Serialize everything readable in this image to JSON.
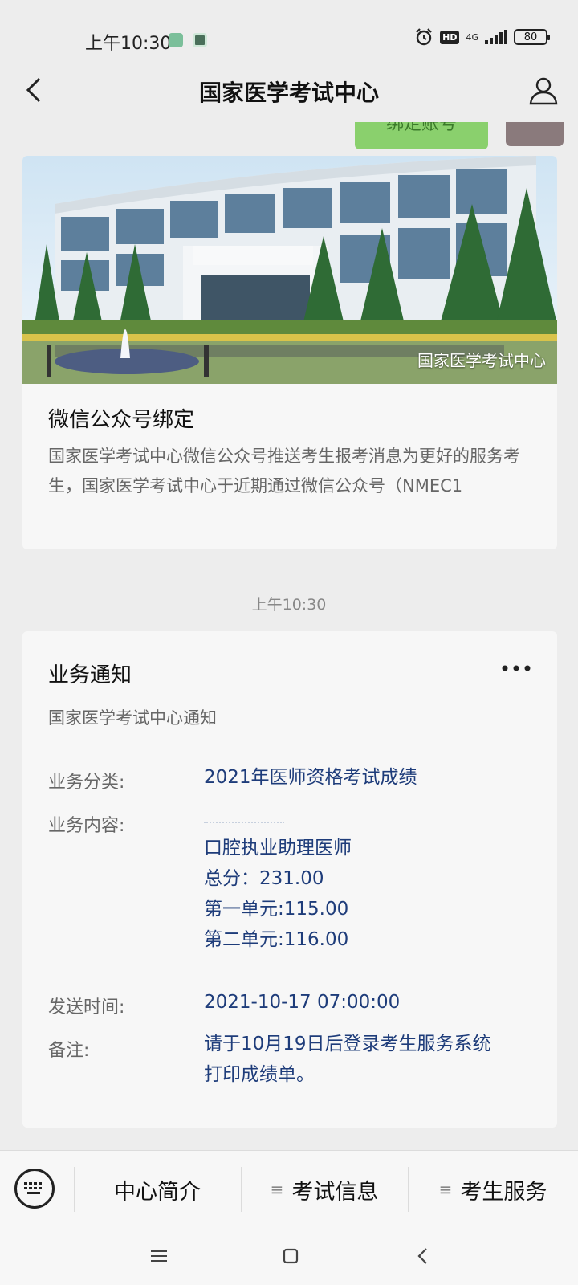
{
  "status_bar": {
    "time": "上午10:30",
    "network": "4G",
    "hd": "HD",
    "battery": "80"
  },
  "nav": {
    "title": "国家医学考试中心"
  },
  "peek": {
    "button_label": "绑定账号"
  },
  "article": {
    "image_caption": "国家医学考试中心",
    "title": "微信公众号绑定",
    "summary": "国家医学考试中心微信公众号推送考生报考消息为更好的服务考生，国家医学考试中心于近期通过微信公众号（NMEC1"
  },
  "timestamp": "上午10:30",
  "notice": {
    "title": "业务通知",
    "subtitle": "国家医学考试中心通知",
    "category_label": "业务分类:",
    "category_value": "2021年医师资格考试成绩",
    "content_label": "业务内容:",
    "content_lines": [
      "口腔执业助理医师",
      "总分：231.00",
      "第一单元:115.00",
      "第二单元:116.00"
    ],
    "send_time_label": "发送时间:",
    "send_time_value": "2021-10-17 07:00:00",
    "remark_label": "备注:",
    "remark_lines": [
      "请于10月19日后登录考生服务系统",
      "打印成绩单。"
    ]
  },
  "bottom_menu": {
    "items": [
      "中心简介",
      "考试信息",
      "考生服务"
    ]
  },
  "colors": {
    "page_bg": "#ededed",
    "card_bg": "#f7f7f7",
    "value_blue": "#1e3c7a",
    "muted": "#666666",
    "green_button": "#8ad06d"
  }
}
